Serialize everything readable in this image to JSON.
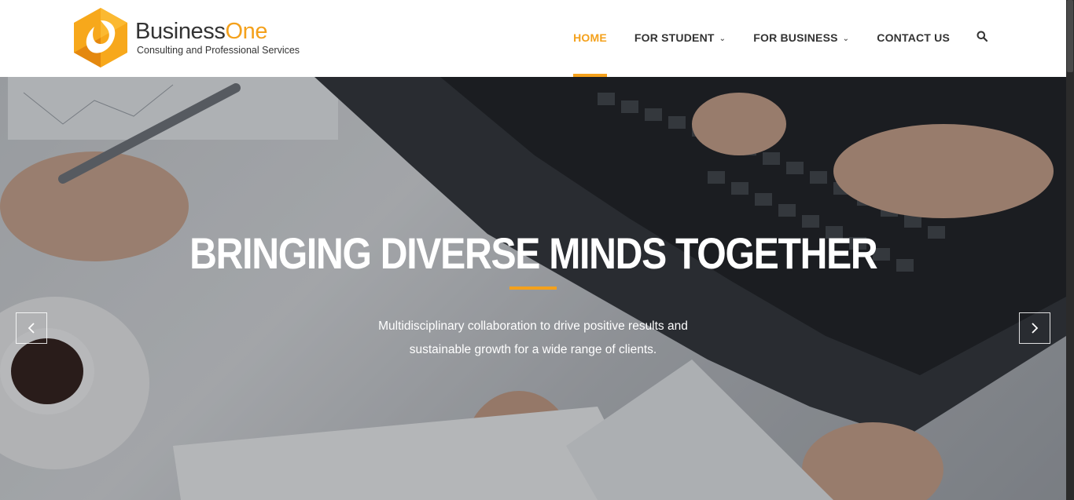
{
  "brand": {
    "name_main": "Business",
    "name_accent": "One",
    "tagline": "Consulting and Professional Services",
    "accent_color": "#f4a11c"
  },
  "nav": {
    "items": [
      {
        "label": "HOME",
        "active": true
      },
      {
        "label": "FOR STUDENT",
        "dropdown": true
      },
      {
        "label": "FOR BUSINESS",
        "dropdown": true
      },
      {
        "label": "CONTACT US"
      }
    ],
    "search_icon": "search-icon",
    "caret_glyph": "⌄"
  },
  "hero": {
    "title": "BRINGING DIVERSE MINDS TOGETHER",
    "subtitle_line1": "Multidisciplinary collaboration to drive positive results and",
    "subtitle_line2": "sustainable growth for a wide range of clients.",
    "prev_icon": "chevron-left-icon",
    "next_icon": "chevron-right-icon",
    "background_image": "office-desk-laptop-hands-photo"
  }
}
